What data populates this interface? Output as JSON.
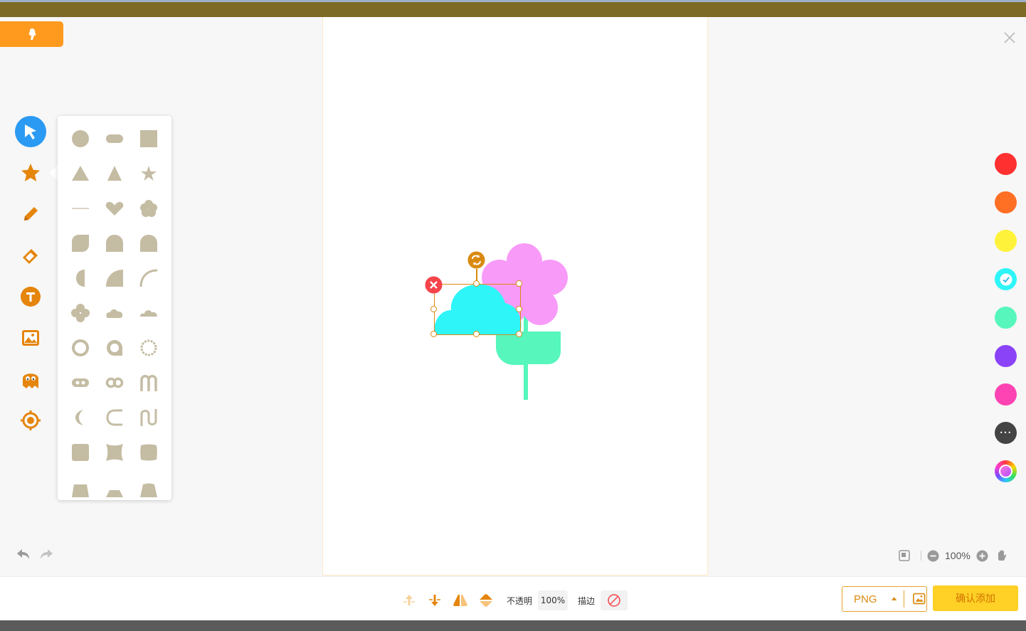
{
  "colors": {
    "accent": "#d98a11",
    "active_tool": "#2b9af3",
    "shape_gray": "#c4bca3",
    "cloud": "#2ef5f8",
    "flower": "#f89af8",
    "leaf": "#56f6bc",
    "confirm": "#ffd026"
  },
  "toolbar": {
    "tools": [
      {
        "icon": "cursor-select-icon",
        "active": true
      },
      {
        "icon": "star-shape-icon",
        "active": false
      },
      {
        "icon": "pencil-icon",
        "active": false
      },
      {
        "icon": "eraser-icon",
        "active": false
      },
      {
        "icon": "text-tool-icon",
        "active": false
      },
      {
        "icon": "image-icon",
        "active": false
      },
      {
        "icon": "ghost-sticker-icon",
        "active": false
      },
      {
        "icon": "target-icon",
        "active": false
      }
    ]
  },
  "shape_palette": {
    "shapes": [
      "circle",
      "rounded-rect",
      "square",
      "triangle",
      "triangle-narrow",
      "star",
      "line",
      "heart",
      "flower",
      "leaf",
      "semicircle-top",
      "arch",
      "half-moon",
      "quarter-circle",
      "arc",
      "cross",
      "cloud",
      "cloud-flat",
      "ring",
      "speech-ring",
      "dotted-ring",
      "pill-dots",
      "infinity",
      "m-shape",
      "crescent",
      "c-shape",
      "s-curve",
      "rounded-square",
      "concave-square",
      "barrel",
      "trapezoid",
      "trapezoid-low",
      "trapezoid-rounded"
    ]
  },
  "colors_panel": {
    "swatches": [
      {
        "color": "#fe3030",
        "selected": false
      },
      {
        "color": "#ff6f24",
        "selected": false
      },
      {
        "color": "#fff23a",
        "selected": false
      },
      {
        "color": "#2ef5f8",
        "selected": true
      },
      {
        "color": "#56f6bc",
        "selected": false
      },
      {
        "color": "#8b43f7",
        "selected": false
      },
      {
        "color": "#fe44b2",
        "selected": false
      },
      {
        "color": "#444444",
        "selected": false,
        "icon": "more-icon"
      },
      {
        "color": "rainbow",
        "selected": false,
        "icon": "color-wheel-icon"
      }
    ]
  },
  "zoom": {
    "level": "100%"
  },
  "bottom": {
    "opacity_label": "不透明",
    "opacity_value": "100%",
    "stroke_label": "描边",
    "format": "PNG",
    "confirm_label": "确认添加"
  }
}
